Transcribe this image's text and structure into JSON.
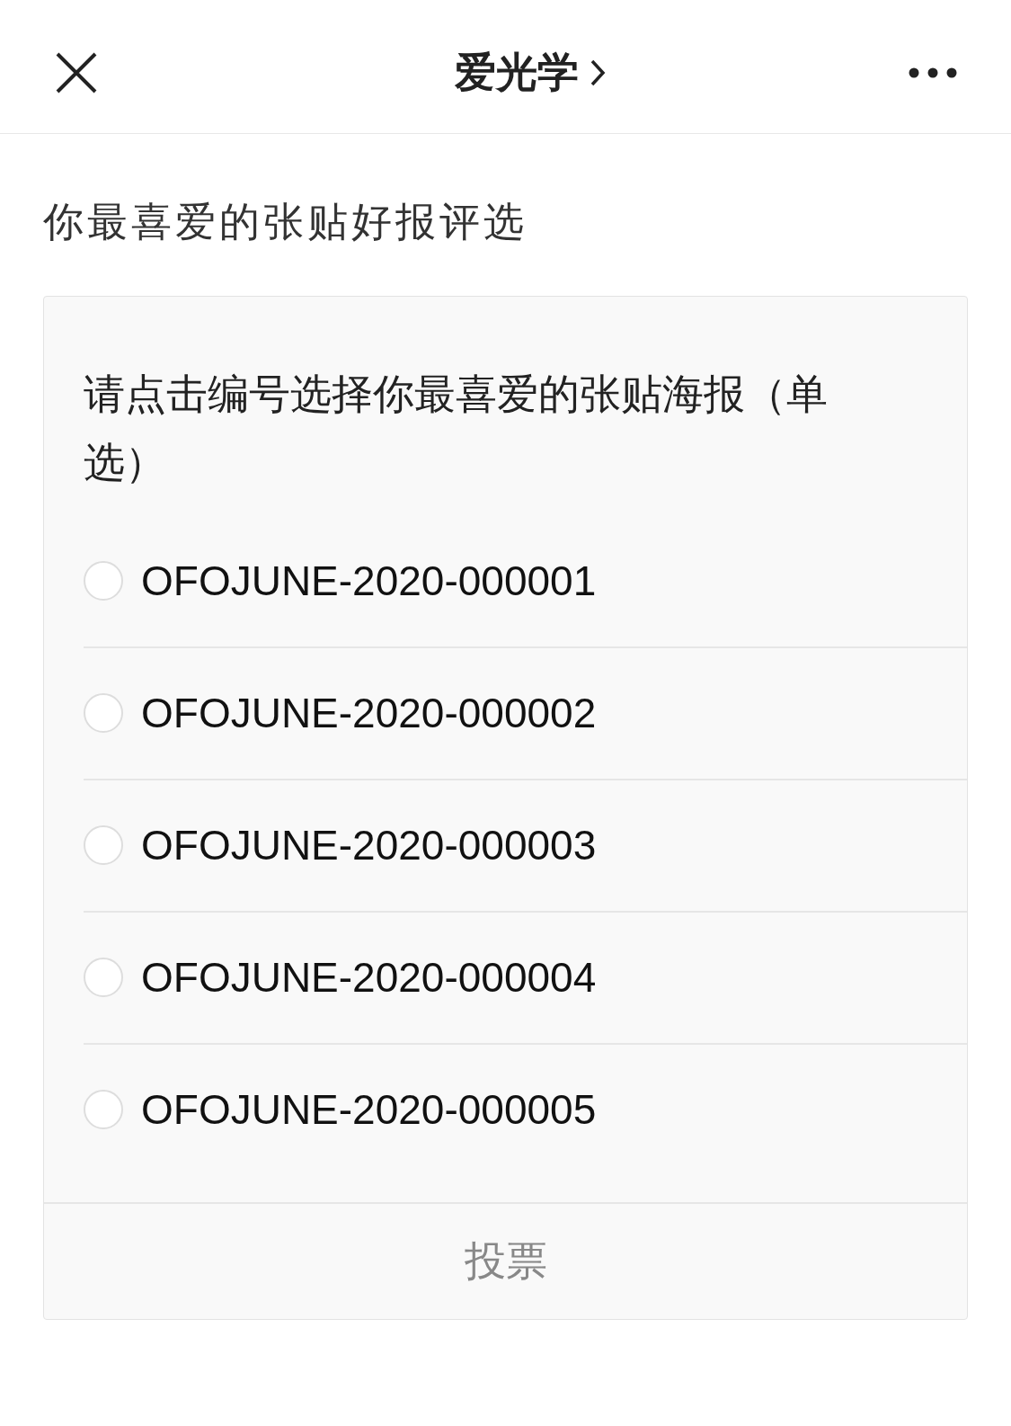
{
  "header": {
    "title": "爱光学"
  },
  "page_title": "你最喜爱的张贴好报评选",
  "question": {
    "text": "请点击编号选择你最喜爱的张贴海报（单选）",
    "options": [
      {
        "label": "OFOJUNE-2020-000001",
        "selected": false
      },
      {
        "label": "OFOJUNE-2020-000002",
        "selected": false
      },
      {
        "label": "OFOJUNE-2020-000003",
        "selected": false
      },
      {
        "label": "OFOJUNE-2020-000004",
        "selected": false
      },
      {
        "label": "OFOJUNE-2020-000005",
        "selected": false
      }
    ]
  },
  "vote_button": {
    "label": "投票",
    "disabled": true
  }
}
